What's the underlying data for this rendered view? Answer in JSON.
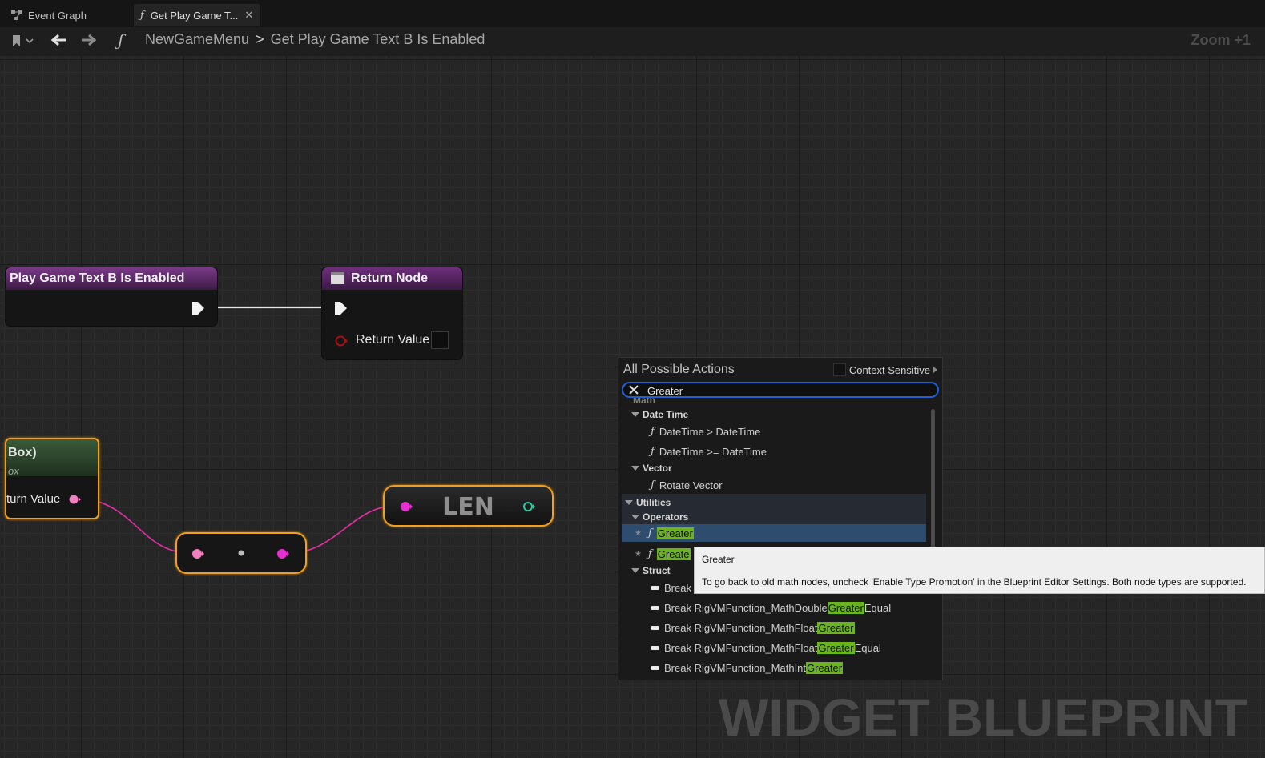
{
  "tabs": [
    {
      "label": "Event Graph",
      "icon": "graph-icon"
    },
    {
      "label": "Get Play Game T...",
      "icon": "function-icon"
    }
  ],
  "toolbar": {
    "function_glyph": "ƒ",
    "breadcrumb_root": "NewGameMenu",
    "breadcrumb_sep": ">",
    "breadcrumb_current": "Get Play Game Text B Is Enabled",
    "zoom": "Zoom +1"
  },
  "nodes": {
    "entry": {
      "title": "Play Game Text B Is Enabled"
    },
    "return": {
      "title": "Return Node",
      "pin": "Return Value"
    },
    "getter": {
      "title": "Box)",
      "subtitle": "ox",
      "pin": "turn Value"
    },
    "len": {
      "title": "LEN"
    }
  },
  "menu": {
    "title": "All Possible Actions",
    "context_sensitive": "Context Sensitive",
    "search_value": "Greater",
    "partial_header": "Math",
    "items": {
      "date_time": "Date Time",
      "dt_gt": "DateTime > DateTime",
      "dt_ge": "DateTime >= DateTime",
      "vector": "Vector",
      "rotate_vector": "Rotate Vector",
      "utilities": "Utilities",
      "operators": "Operators",
      "greater": "Greater",
      "greater2": "Greate",
      "struct": "Struct",
      "break1": "Break",
      "break2_pre": "Break RigVMFunction_MathDouble",
      "break2_hl": "Greater",
      "break2_post": "Equal",
      "break3_pre": "Break RigVMFunction_MathFloat",
      "break3_hl": "Greater",
      "break4_pre": "Break RigVMFunction_MathFloat",
      "break4_hl": "Greater",
      "break4_post": "Equal",
      "break5_pre": "Break RigVMFunction_MathInt",
      "break5_hl": "Greater"
    }
  },
  "tooltip": {
    "title": "Greater",
    "body": "To go back to old math nodes, uncheck 'Enable Type Promotion' in the Blueprint Editor Settings. Both node types are supported."
  },
  "watermark": "WIDGET BLUEPRINT",
  "colors": {
    "function_header": "#6b2a7a",
    "string_pin": "#e62fa5",
    "integer_pin": "#1fd1a0",
    "highlight": "#6ab41e",
    "selection": "#2a4a6e",
    "search_border": "#1f5fd1"
  }
}
